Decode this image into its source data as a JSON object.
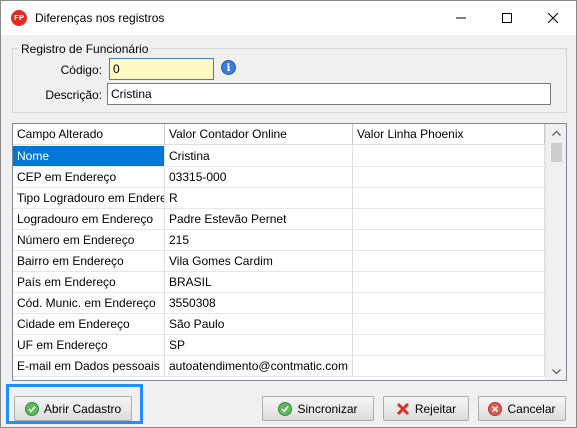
{
  "window": {
    "title": "Diferenças nos registros",
    "app_icon_text": "FP"
  },
  "group": {
    "legend": "Registro de Funcionário",
    "codigo_label": "Código:",
    "codigo_value": "0",
    "descricao_label": "Descrição:",
    "descricao_value": "Cristina"
  },
  "grid": {
    "columns": [
      "Campo Alterado",
      "Valor Contador Online",
      "Valor Linha Phoenix"
    ],
    "rows": [
      [
        "Nome",
        "Cristina",
        ""
      ],
      [
        "CEP em Endereço",
        "03315-000",
        ""
      ],
      [
        "Tipo Logradouro em Endere",
        "R",
        ""
      ],
      [
        "Logradouro em Endereço",
        "Padre Estevão Pernet",
        ""
      ],
      [
        "Número em Endereço",
        "215",
        ""
      ],
      [
        "Bairro em Endereço",
        "Vila Gomes Cardim",
        ""
      ],
      [
        "País em Endereço",
        "BRASIL",
        ""
      ],
      [
        "Cód. Munic. em Endereço",
        "3550308",
        ""
      ],
      [
        "Cidade em Endereço",
        "São Paulo",
        ""
      ],
      [
        "UF em Endereço",
        "SP",
        ""
      ],
      [
        "E-mail em Dados pessoais",
        "autoatendimento@contmatic.com",
        ""
      ]
    ],
    "selected_row": 0
  },
  "buttons": {
    "abrir": "Abrir Cadastro",
    "sincronizar": "Sincronizar",
    "rejeitar": "Rejeitar",
    "cancelar": "Cancelar"
  },
  "colors": {
    "selection": "#0078d7",
    "focus_ring": "#1e90ff",
    "check_green": "#4caf50",
    "reject_red": "#d93025"
  }
}
